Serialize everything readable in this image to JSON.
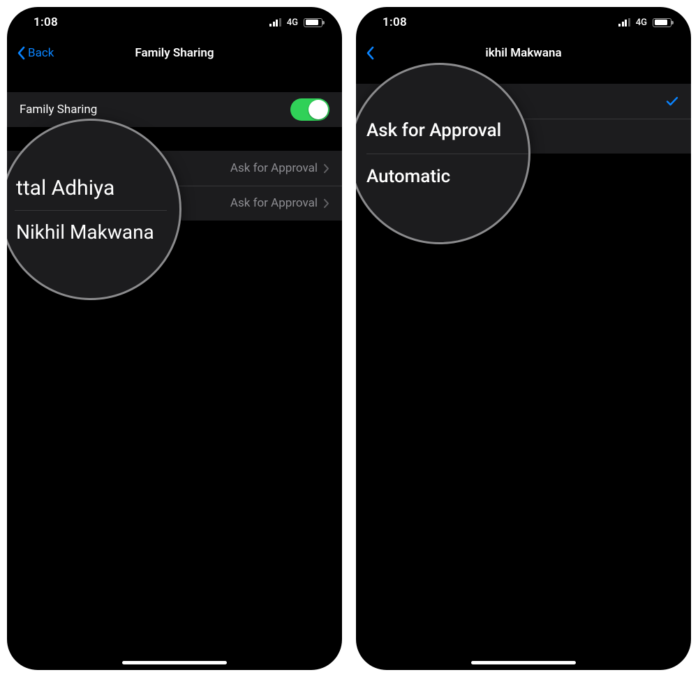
{
  "status": {
    "time": "1:08",
    "network": "4G"
  },
  "left": {
    "nav_back": "Back",
    "nav_title": "Family Sharing",
    "toggle_label": "Family Sharing",
    "members": [
      {
        "name_display": "",
        "value": "Ask for Approval"
      },
      {
        "name_display": "",
        "value": "Ask for Approval"
      }
    ],
    "lens": {
      "line1": "ttal Adhiya",
      "line2": "Nikhil Makwana"
    }
  },
  "right": {
    "nav_title": "ikhil Makwana",
    "options": [
      {
        "label": "",
        "selected": true
      },
      {
        "label": "",
        "selected": false
      }
    ],
    "lens": {
      "line1": "Ask for Approval",
      "line2": "Automatic"
    }
  }
}
